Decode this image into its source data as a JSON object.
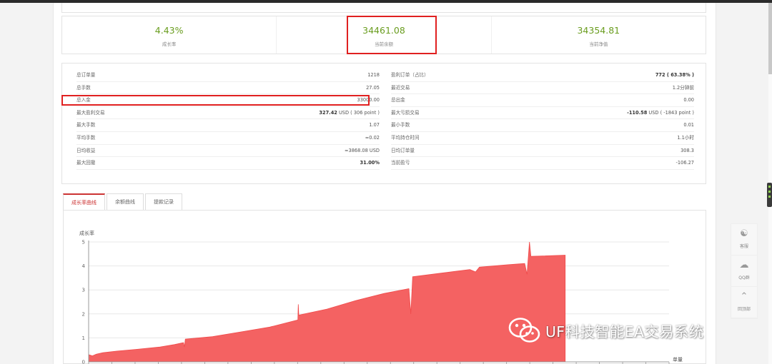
{
  "summary": [
    {
      "value": "4.43%",
      "label": "成长率"
    },
    {
      "value": "34461.08",
      "label": "当前余额"
    },
    {
      "value": "34354.81",
      "label": "当前净值"
    }
  ],
  "stats_left": [
    {
      "label": "总订单量",
      "value": "1218",
      "bold": ""
    },
    {
      "label": "总手数",
      "value": "27.05",
      "bold": ""
    },
    {
      "label": "总入金",
      "value": "33000.00",
      "bold": ""
    },
    {
      "label": "最大盈利交易",
      "value": " USD ( 306 point )",
      "bold": "327.42"
    },
    {
      "label": "最大手数",
      "value": "1.07",
      "bold": ""
    },
    {
      "label": "平均手数",
      "value": "≈0.02",
      "bold": ""
    },
    {
      "label": "日均收益",
      "value": "≈3868.08 USD",
      "bold": ""
    },
    {
      "label": "最大回撤",
      "value": "",
      "bold": "31.00%"
    }
  ],
  "stats_right": [
    {
      "label": "盈利订单（占比）",
      "value": "",
      "bold": "772 ( 63.38% )"
    },
    {
      "label": "最近交易",
      "value": "1.2分钟前",
      "bold": ""
    },
    {
      "label": "总出金",
      "value": "0.00",
      "bold": ""
    },
    {
      "label": "最大亏损交易",
      "value": " USD ( -1843 point )",
      "bold": "-110.58"
    },
    {
      "label": "最小手数",
      "value": "0.01",
      "bold": ""
    },
    {
      "label": "平均持仓时间",
      "value": "1.1小时",
      "bold": ""
    },
    {
      "label": "日均订单量",
      "value": "308.3",
      "bold": ""
    },
    {
      "label": "当前盈亏",
      "value": "-106.27",
      "bold": ""
    }
  ],
  "tabs": [
    "成长率曲线",
    "余额曲线",
    "提款记录"
  ],
  "side_tools": [
    {
      "icon": "headset-icon",
      "label": "客服"
    },
    {
      "icon": "qq-icon",
      "label": "QQ群"
    },
    {
      "icon": "chevron-up-icon",
      "label": "回顶部"
    }
  ],
  "watermark": "UF科技智能EA交易系统",
  "chart_data": {
    "type": "area",
    "ylabel": "成长率",
    "xlabel": "单量",
    "yticks": [
      "0",
      "1",
      "2",
      "3",
      "4",
      "5"
    ],
    "ylim": [
      0,
      5
    ],
    "xlim": [
      0,
      1218
    ],
    "grid": true,
    "color": "#f46262",
    "points": [
      [
        0,
        0.3
      ],
      [
        8,
        0.25
      ],
      [
        16,
        0.32
      ],
      [
        30,
        0.38
      ],
      [
        60,
        0.45
      ],
      [
        100,
        0.52
      ],
      [
        150,
        0.62
      ],
      [
        180,
        0.72
      ],
      [
        199,
        0.8
      ],
      [
        201,
        0.62
      ],
      [
        203,
        0.95
      ],
      [
        260,
        1.05
      ],
      [
        320,
        1.25
      ],
      [
        380,
        1.45
      ],
      [
        439,
        1.75
      ],
      [
        440,
        2.4
      ],
      [
        441,
        1.95
      ],
      [
        500,
        2.2
      ],
      [
        560,
        2.55
      ],
      [
        620,
        2.85
      ],
      [
        672,
        3.05
      ],
      [
        676,
        2.0
      ],
      [
        680,
        3.55
      ],
      [
        740,
        3.7
      ],
      [
        800,
        3.85
      ],
      [
        812,
        3.75
      ],
      [
        820,
        3.95
      ],
      [
        880,
        4.05
      ],
      [
        915,
        4.1
      ],
      [
        920,
        3.65
      ],
      [
        925,
        5.0
      ],
      [
        928,
        4.4
      ],
      [
        1000,
        4.45
      ]
    ]
  }
}
